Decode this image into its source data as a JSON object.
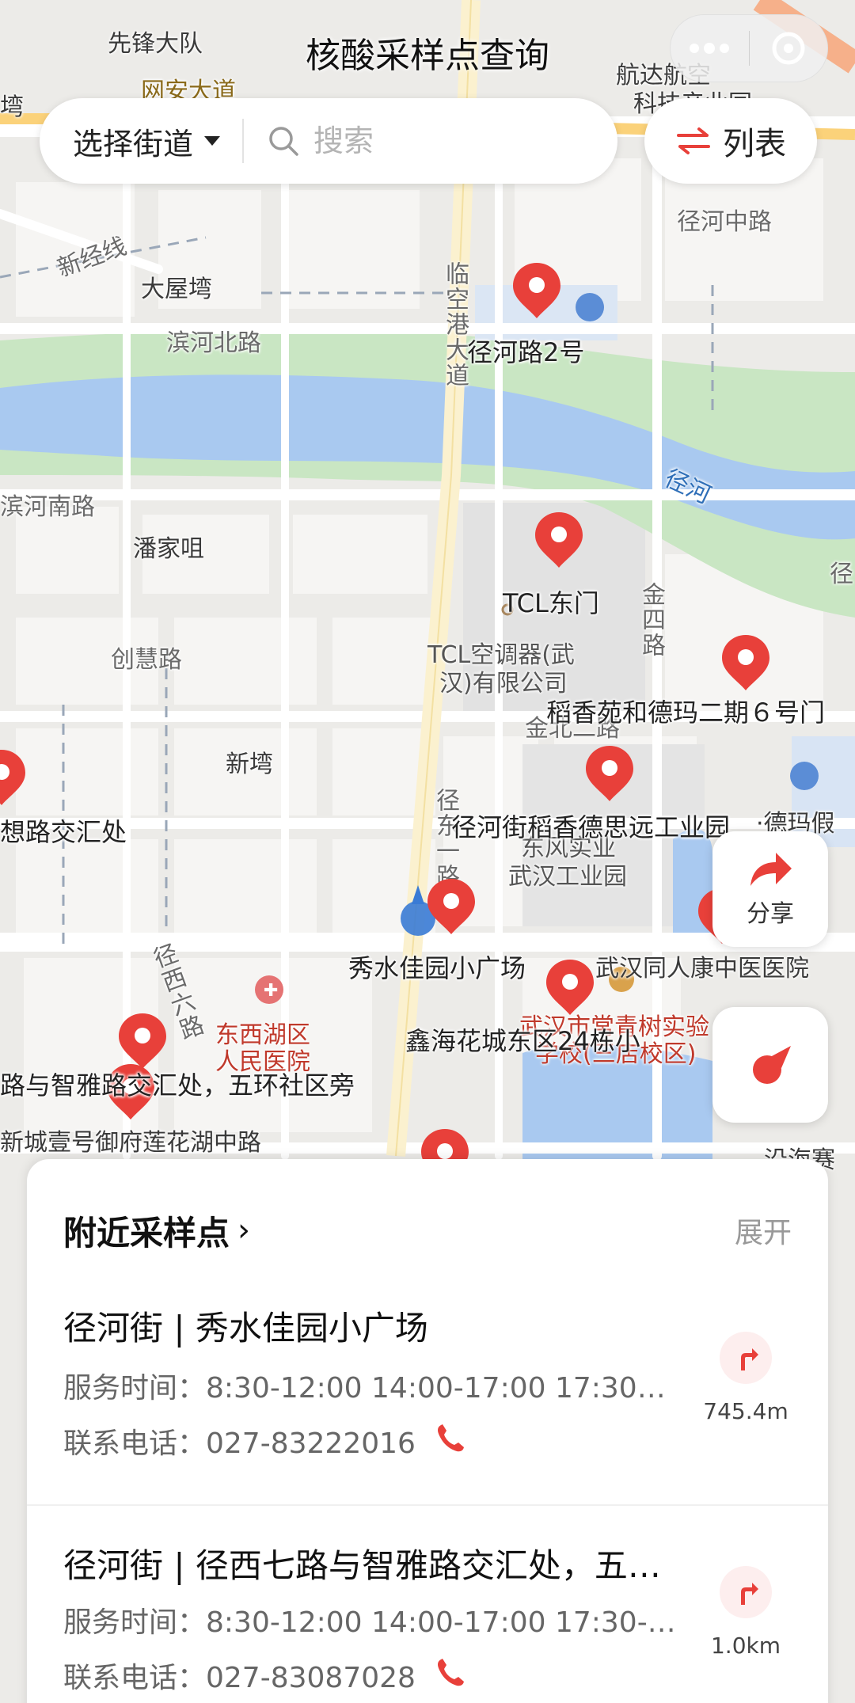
{
  "header": {
    "title": "核酸采样点查询"
  },
  "search": {
    "street_select_label": "选择街道",
    "placeholder": "搜索"
  },
  "list_button": {
    "label": "列表"
  },
  "share_button": {
    "label": "分享"
  },
  "map": {
    "labels": {
      "xianfeng": "先锋大队",
      "wangan": "网安大道",
      "hangda": "航达航空",
      "hangda2": "科技产业园",
      "jinghezhonglu": "径河中路",
      "xinjingxian": "新经线",
      "dawuwan": "大屋塆",
      "binhebeilu": "滨河北路",
      "linkonggang": "临空港大道",
      "jinghe": "径河",
      "binhenanlu": "滨河南路",
      "panjiazui": "潘家咀",
      "chuanghuilu": "创慧路",
      "tcl_company1": "TCL空调器(武",
      "tcl_company2": "汉)有限公司",
      "jinsilu": "金四路",
      "jinbeierlu": "金北二路",
      "xinwan": "新塆",
      "dongfeng1": "东风实业",
      "dongfeng2": "武汉工业园",
      "jingdongyilu": "径东一路",
      "jingxiliulu": "径西六路",
      "hospital1": "东西湖区",
      "hospital2": "人民医院",
      "wuhan_tongrenkang": "武汉同人康中医医院",
      "school1": "武汉市常青树实验",
      "school2": "学校(三店校区)",
      "xinchengyihao": "新城壹号御府莲花湖中路",
      "dema": "·德玛假",
      "yanhai": "沿海赛",
      "jingliu": "径",
      "wan": "塆",
      "zhi": "智"
    },
    "pins": {
      "p1": "径河路2号",
      "p2": "TCL东门",
      "p3": "稻香苑和德玛二期６号门",
      "p4": "径河街稻香德思远工业园",
      "p5": "秀水佳园小广场",
      "p6": "鑫海花城东区24栋小",
      "p7": "路与智雅路交汇处，五环社区旁",
      "p8": "想路交汇处"
    }
  },
  "panel": {
    "title": "附近采样点",
    "expand_label": "展开",
    "sites": [
      {
        "name": "径河街 | 秀水佳园小广场",
        "hours": "服务时间：8:30-12:00 14:00-17:00 17:30…",
        "phone": "联系电话：027-83222016",
        "distance": "745.4m"
      },
      {
        "name": "径河街 | 径西七路与智雅路交汇处，五…",
        "hours": "服务时间：8:30-12:00 14:00-17:00 17:30-…",
        "phone": "联系电话：027-83087028",
        "distance": "1.0km"
      }
    ]
  },
  "colors": {
    "accent": "#e8403a",
    "water": "#a9c9f0",
    "park": "#c9e6c3",
    "road": "#ffffff",
    "block": "#f4f3f1"
  }
}
